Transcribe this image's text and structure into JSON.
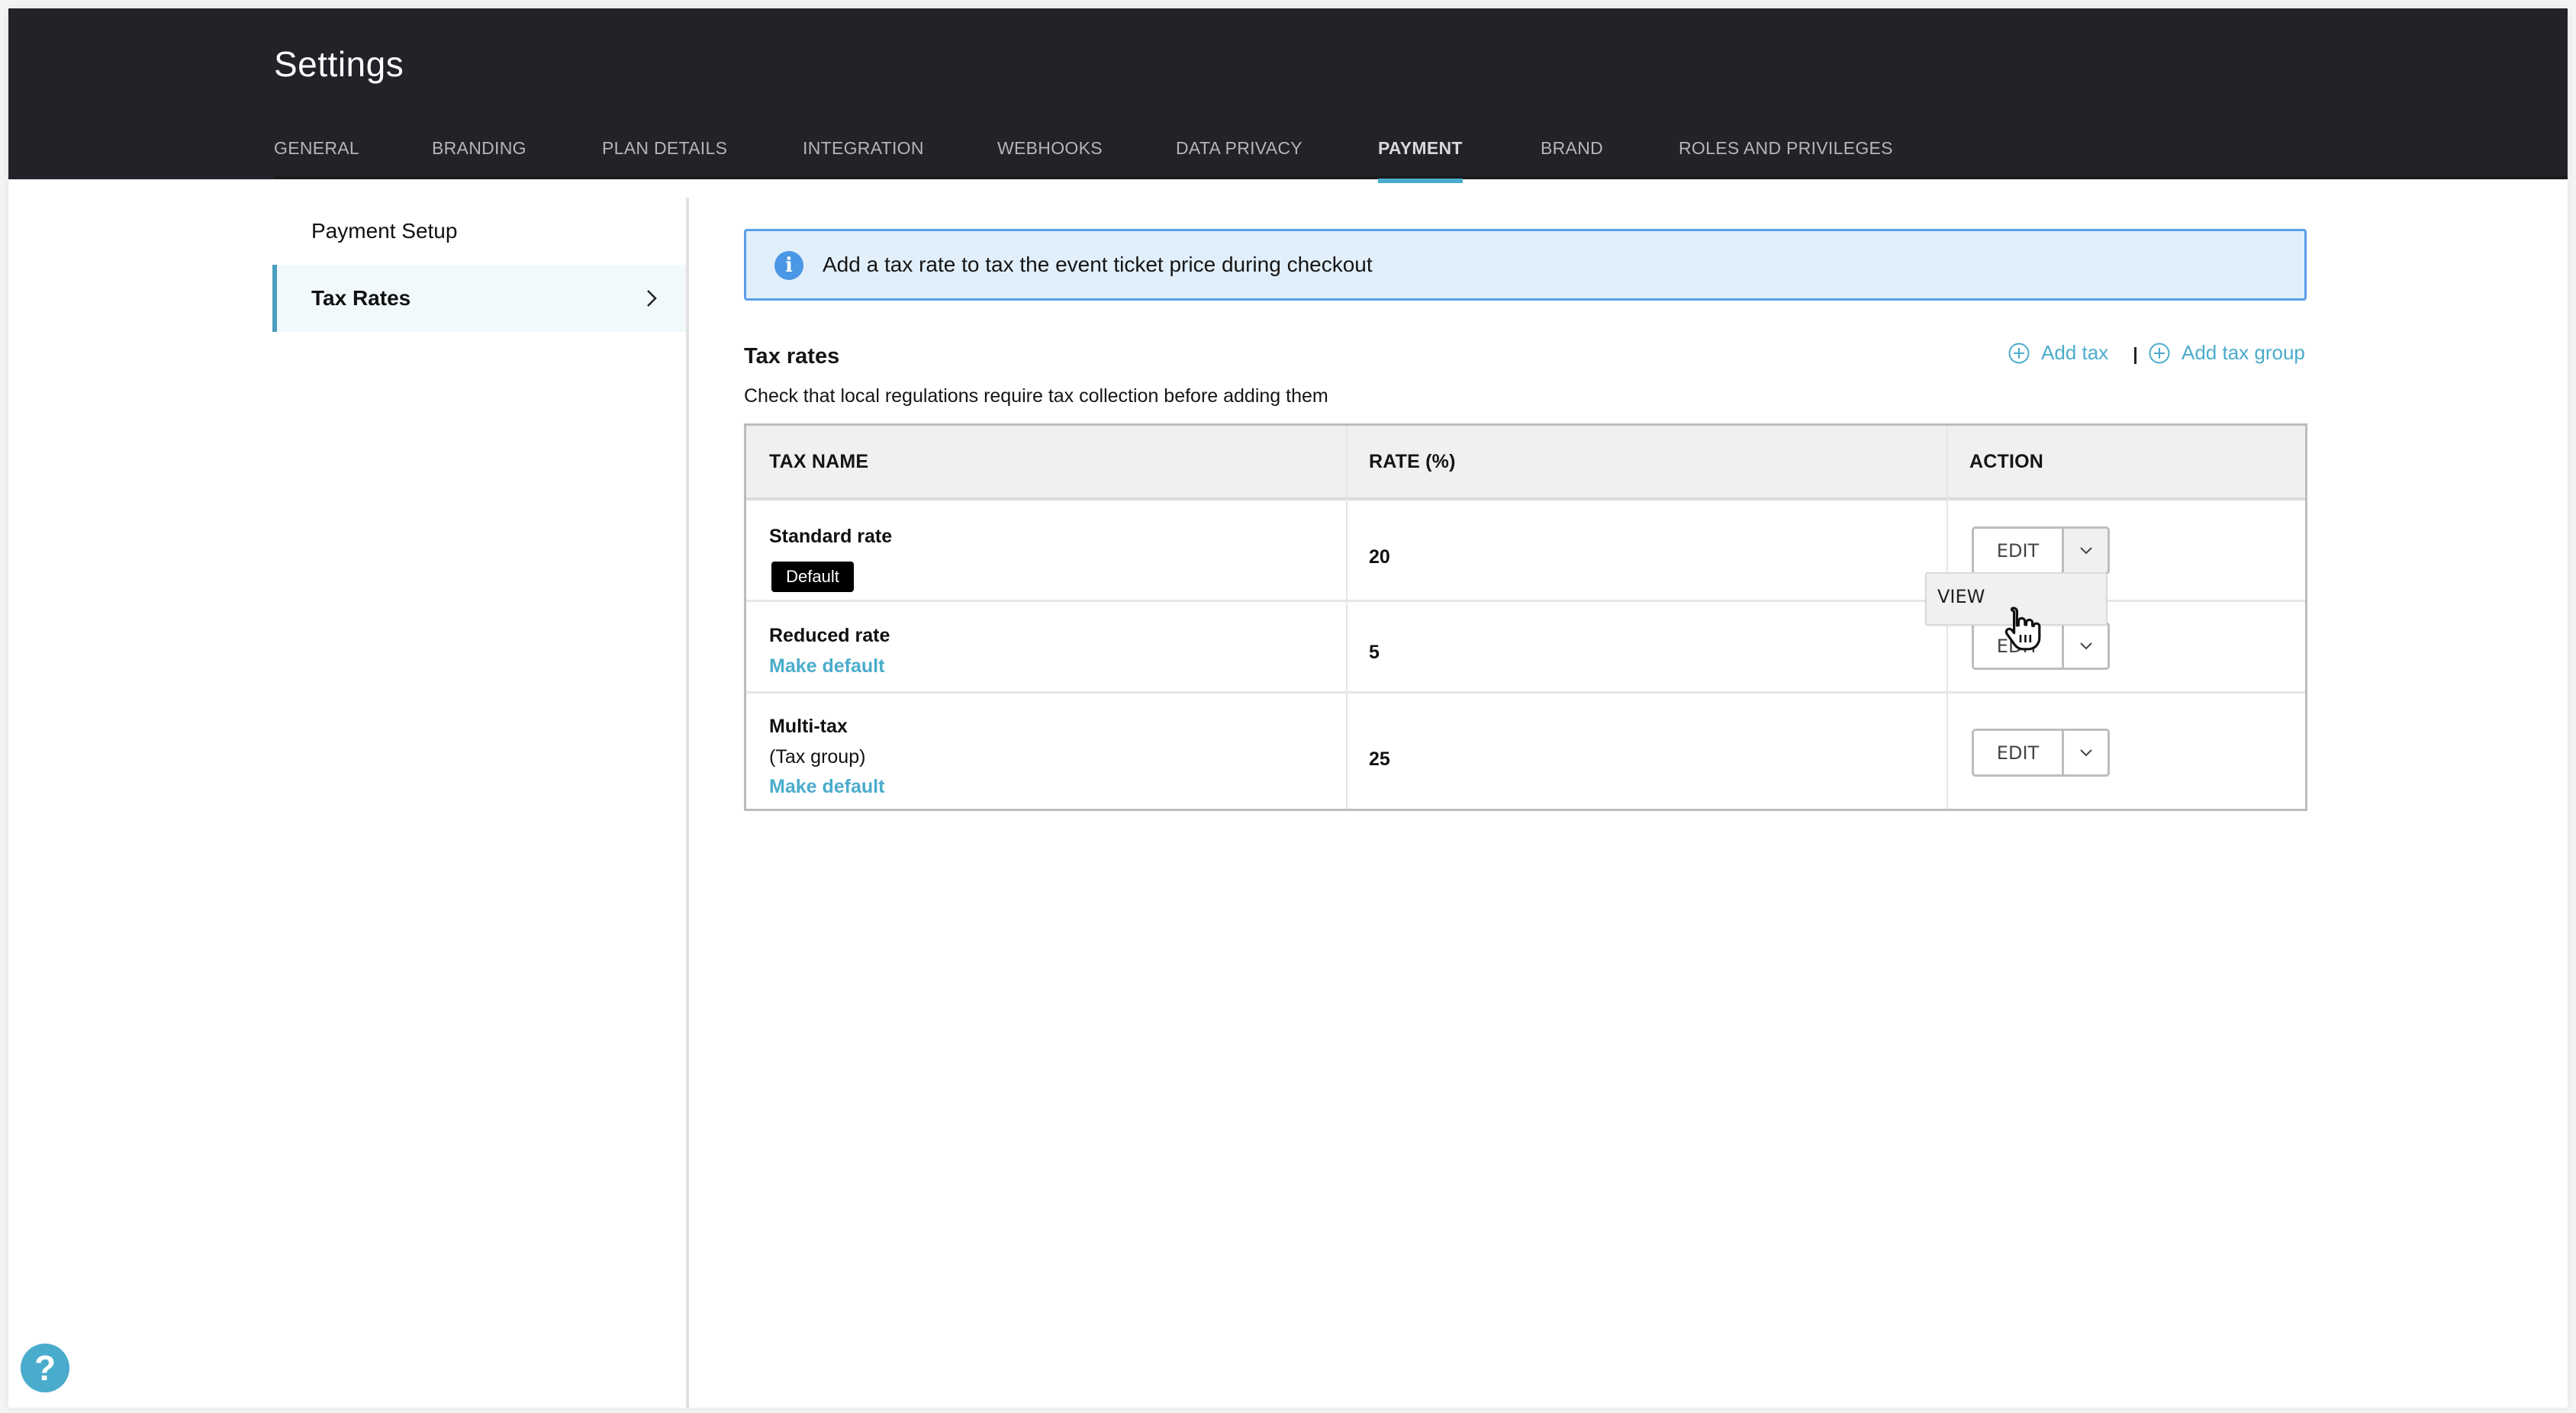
{
  "header": {
    "title": "Settings",
    "tabs": [
      {
        "label": "GENERAL",
        "active": false
      },
      {
        "label": "BRANDING",
        "active": false
      },
      {
        "label": "PLAN DETAILS",
        "active": false
      },
      {
        "label": "INTEGRATION",
        "active": false
      },
      {
        "label": "WEBHOOKS",
        "active": false
      },
      {
        "label": "DATA PRIVACY",
        "active": false
      },
      {
        "label": "PAYMENT",
        "active": true
      },
      {
        "label": "BRAND",
        "active": false
      },
      {
        "label": "ROLES AND PRIVILEGES",
        "active": false
      }
    ]
  },
  "sidebar": {
    "items": [
      {
        "label": "Payment Setup",
        "active": false
      },
      {
        "label": "Tax Rates",
        "active": true,
        "icon": "chevron-right-icon"
      }
    ]
  },
  "banner": {
    "icon": "info-icon",
    "icon_glyph": "i",
    "text": "Add a tax rate to tax the event ticket price during checkout"
  },
  "section": {
    "title": "Tax rates",
    "subtitle": "Check that local regulations require tax collection before adding them",
    "add_tax_label": "Add tax",
    "separator": "|",
    "add_tax_group_label": "Add tax group"
  },
  "table": {
    "columns": [
      "TAX NAME",
      "RATE (%)",
      "ACTION"
    ],
    "rows": [
      {
        "name": "Standard rate",
        "badge": "Default",
        "rate": "20",
        "action": "EDIT",
        "dropdown_open": true
      },
      {
        "name": "Reduced rate",
        "link": "Make default",
        "rate": "5",
        "action": "EDIT",
        "dropdown_open": false
      },
      {
        "name": "Multi-tax",
        "subtitle": "(Tax group)",
        "link": "Make default",
        "rate": "25",
        "action": "EDIT",
        "dropdown_open": false
      }
    ]
  },
  "dropdown_menu": {
    "items": [
      "VIEW"
    ]
  },
  "help": {
    "glyph": "?"
  },
  "colors": {
    "header_bg": "#222328",
    "accent": "#4aaccc",
    "banner_bg": "#e1effb",
    "banner_border": "#5a9ee8",
    "badge_bg": "#000000"
  }
}
